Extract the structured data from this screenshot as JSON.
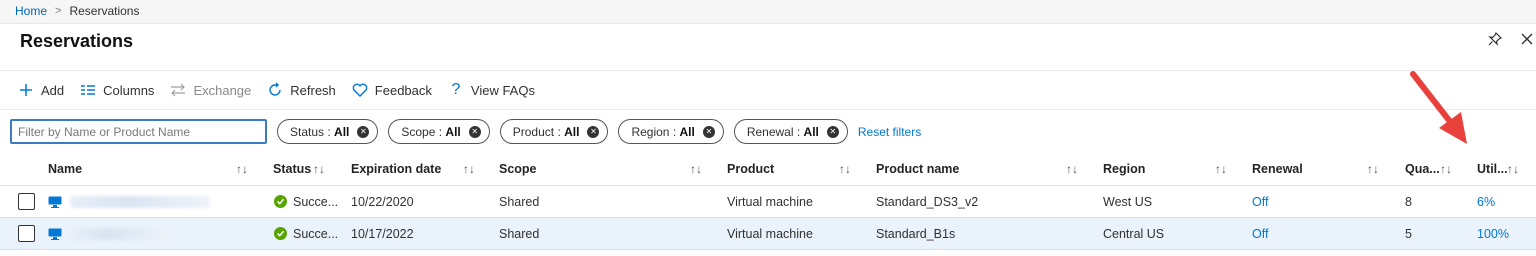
{
  "breadcrumb": {
    "home": "Home",
    "separator": ">",
    "current": "Reservations"
  },
  "page": {
    "title": "Reservations"
  },
  "toolbar": {
    "add": "Add",
    "columns": "Columns",
    "exchange": "Exchange",
    "refresh": "Refresh",
    "feedback": "Feedback",
    "faqs": "View FAQs"
  },
  "filters": {
    "search_placeholder": "Filter by Name or Product Name",
    "pills": [
      {
        "label": "Status : ",
        "value": "All"
      },
      {
        "label": "Scope : ",
        "value": "All"
      },
      {
        "label": "Product : ",
        "value": "All"
      },
      {
        "label": "Region : ",
        "value": "All"
      },
      {
        "label": "Renewal : ",
        "value": "All"
      }
    ],
    "reset": "Reset filters"
  },
  "table": {
    "columns": {
      "name": "Name",
      "status": "Status",
      "expiration": "Expiration date",
      "scope": "Scope",
      "product": "Product",
      "product_name": "Product name",
      "region": "Region",
      "renewal": "Renewal",
      "quantity": "Qua...",
      "utilization": "Util..."
    },
    "sort_glyph": "↑↓",
    "rows": [
      {
        "status": "Succe...",
        "expiration": "10/22/2020",
        "scope": "Shared",
        "product": "Virtual machine",
        "product_name": "Standard_DS3_v2",
        "region": "West US",
        "renewal": "Off",
        "quantity": "8",
        "utilization": "6%"
      },
      {
        "status": "Succe...",
        "expiration": "10/17/2022",
        "scope": "Shared",
        "product": "Virtual machine",
        "product_name": "Standard_B1s",
        "region": "Central US",
        "renewal": "Off",
        "quantity": "5",
        "utilization": "100%"
      }
    ]
  },
  "colors": {
    "accent": "#0078d4",
    "success": "#57a300",
    "annotation_arrow": "#e8403a"
  },
  "icons": [
    "plus-icon",
    "columns-icon",
    "exchange-icon",
    "refresh-icon",
    "heart-icon",
    "question-icon",
    "pin-icon",
    "close-icon",
    "vm-icon",
    "success-icon"
  ]
}
